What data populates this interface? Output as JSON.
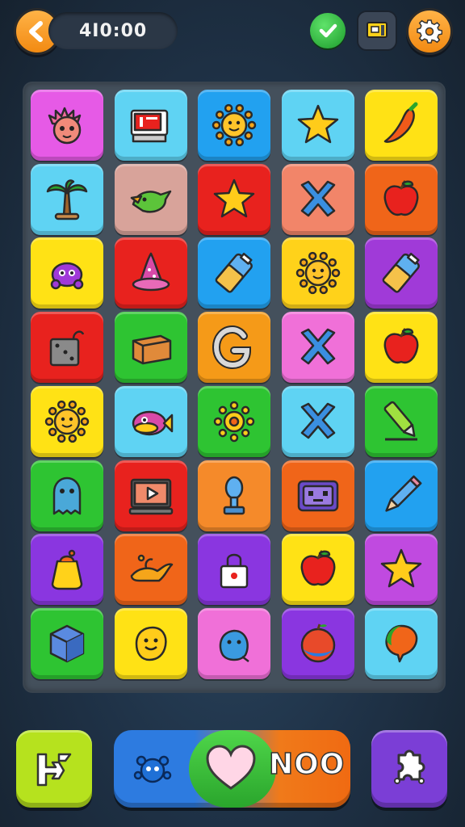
{
  "hud": {
    "back_icon": "chevron-left-icon",
    "timer": "4I0:00",
    "check_icon": "check-bubble-icon",
    "message_icon": "message-card-icon",
    "settings_icon": "gear-icon"
  },
  "board": {
    "rows": 8,
    "cols": 5,
    "tiles": [
      {
        "color": "#e65ae6",
        "icon": "hedgehog-creature"
      },
      {
        "color": "#5fd3f3",
        "icon": "register-machine"
      },
      {
        "color": "#22a1f0",
        "icon": "smiling-sun"
      },
      {
        "color": "#5fd3f3",
        "icon": "star"
      },
      {
        "color": "#ffe215",
        "icon": "chili-pepper"
      },
      {
        "color": "#5fd3f3",
        "icon": "palm-tree"
      },
      {
        "color": "#d8a39a",
        "icon": "green-bird"
      },
      {
        "color": "#e8221e",
        "icon": "star"
      },
      {
        "color": "#f28569",
        "icon": "cross-x"
      },
      {
        "color": "#f06519",
        "icon": "apple"
      },
      {
        "color": "#ffe215",
        "icon": "purple-creature"
      },
      {
        "color": "#e8221e",
        "icon": "wizard-hat"
      },
      {
        "color": "#22a1f0",
        "icon": "battery"
      },
      {
        "color": "#ffd21a",
        "icon": "smiling-sun"
      },
      {
        "color": "#a03ad8",
        "icon": "battery"
      },
      {
        "color": "#e8221e",
        "icon": "dice-bag"
      },
      {
        "color": "#2ec432",
        "icon": "box"
      },
      {
        "color": "#f59a18",
        "icon": "letter-g"
      },
      {
        "color": "#f070d8",
        "icon": "cross-x"
      },
      {
        "color": "#ffe215",
        "icon": "apple"
      },
      {
        "color": "#ffe215",
        "icon": "smiling-sun"
      },
      {
        "color": "#5fd3f3",
        "icon": "fish"
      },
      {
        "color": "#2ec432",
        "icon": "sun-gear"
      },
      {
        "color": "#5fd3f3",
        "icon": "cross-x"
      },
      {
        "color": "#2ec432",
        "icon": "marker-pen"
      },
      {
        "color": "#2ec432",
        "icon": "ghost-creature"
      },
      {
        "color": "#e8221e",
        "icon": "video-screen"
      },
      {
        "color": "#f58a2a",
        "icon": "lamp"
      },
      {
        "color": "#f06519",
        "icon": "retro-tv"
      },
      {
        "color": "#22a1f0",
        "icon": "pencil"
      },
      {
        "color": "#8a36e0",
        "icon": "jar"
      },
      {
        "color": "#f06519",
        "icon": "genie-lamp"
      },
      {
        "color": "#8a36e0",
        "icon": "padlock"
      },
      {
        "color": "#ffe215",
        "icon": "apple"
      },
      {
        "color": "#c04ae0",
        "icon": "star"
      },
      {
        "color": "#2ec432",
        "icon": "cube"
      },
      {
        "color": "#ffe215",
        "icon": "smiling-blob"
      },
      {
        "color": "#f070d8",
        "icon": "blob-creature"
      },
      {
        "color": "#8a36e0",
        "icon": "fruit-ball"
      },
      {
        "color": "#5fd3f3",
        "icon": "balloon"
      }
    ]
  },
  "bottom": {
    "left_button_icon": "arrow-swap-icon",
    "power_blue_icon": "bug-creature-icon",
    "power_heart_icon": "heart-icon",
    "power_text": "NOO",
    "right_button_icon": "puzzle-piece-icon",
    "colors": {
      "left": "#b6e21e",
      "right": "#7b3ed6"
    }
  }
}
